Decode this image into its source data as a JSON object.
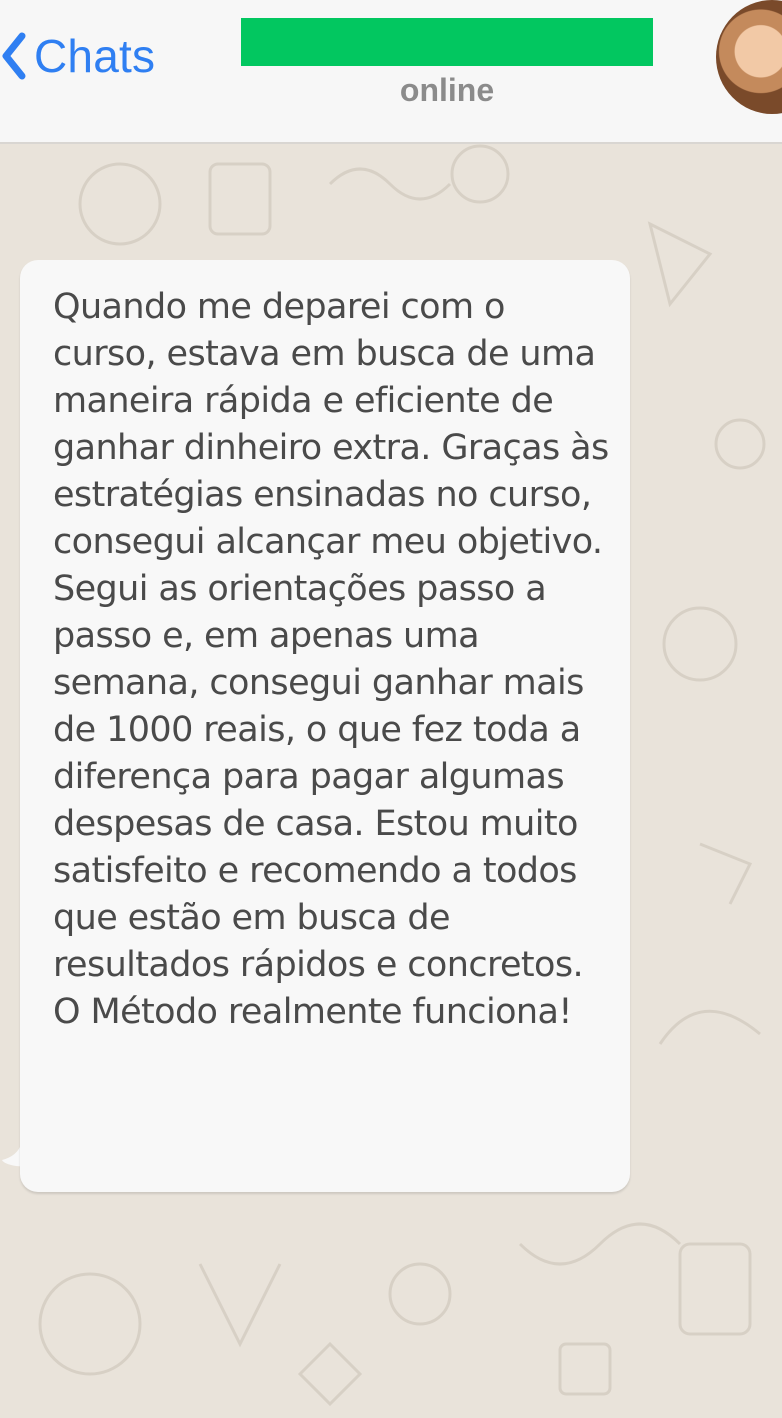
{
  "header": {
    "back_label": "Chats",
    "contact_status": "online",
    "contact_name_redacted_color": "#02c760"
  },
  "chat": {
    "message_text": "Quando me deparei com o curso, estava em busca de uma maneira rápida e eficiente de ganhar dinheiro extra. Graças às estratégias ensinadas no curso, consegui alcançar meu objetivo. Segui as orientações passo a passo e, em apenas uma semana, consegui ganhar mais de 1000 reais, o que fez toda a diferença para pagar algumas despesas de casa. Estou muito satisfeito e recomendo a todos que estão em busca de resultados rápidos e concretos. O Método realmente funciona!"
  },
  "colors": {
    "accent": "#2f7ff2",
    "header_bg": "#f7f7f7",
    "chat_bg": "#e9e3da",
    "bubble_bg": "#f8f8f8"
  },
  "icons": {
    "back": "chevron-left-icon",
    "avatar": "contact-avatar"
  }
}
